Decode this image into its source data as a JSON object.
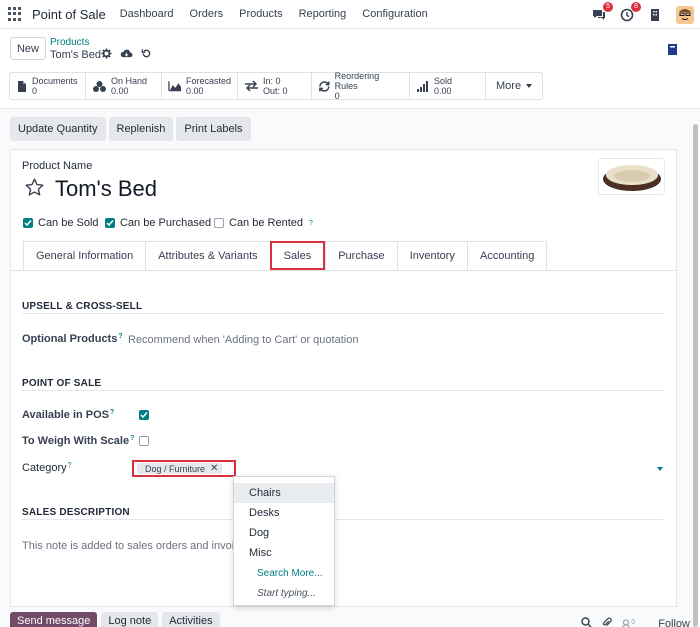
{
  "navbar": {
    "app_name": "Point of Sale",
    "menu": [
      "Dashboard",
      "Orders",
      "Products",
      "Reporting",
      "Configuration"
    ],
    "messages_count": "5",
    "activities_count": "8"
  },
  "control_panel": {
    "new_label": "New",
    "breadcrumb_parent": "Products",
    "breadcrumb_current": "Tom's Bed"
  },
  "smart_buttons": [
    {
      "label": "Documents",
      "value": "0",
      "icon": "document-icon"
    },
    {
      "label": "On Hand",
      "value": "0.00",
      "icon": "boxes-icon"
    },
    {
      "label": "Forecasted",
      "value": "0.00",
      "icon": "area-chart-icon"
    },
    {
      "label": "In: 0",
      "value": "Out: 0",
      "icon": "exchange-icon"
    },
    {
      "label": "Reordering Rules",
      "value": "0",
      "icon": "refresh-icon"
    },
    {
      "label": "Sold",
      "value": "0.00",
      "icon": "signal-icon"
    }
  ],
  "more_label": "More",
  "actions": [
    "Update Quantity",
    "Replenish",
    "Print Labels"
  ],
  "form": {
    "name_label": "Product Name",
    "product_name": "Tom's Bed",
    "can_be_sold": "Can be Sold",
    "can_be_purchased": "Can be Purchased",
    "can_be_rented": "Can be Rented",
    "tabs": [
      "General Information",
      "Attributes & Variants",
      "Sales",
      "Purchase",
      "Inventory",
      "Accounting"
    ],
    "upsell_title": "UPSELL & CROSS-SELL",
    "optional_products_label": "Optional Products",
    "optional_products_placeholder": "Recommend when 'Adding to Cart' or quotation",
    "pos_title": "POINT OF SALE",
    "available_pos_label": "Available in POS",
    "weigh_label": "To Weigh With Scale",
    "category_label": "Category",
    "category_value": "Dog / Furniture",
    "sales_desc_title": "SALES DESCRIPTION",
    "sales_desc_placeholder": "This note is added to sales orders and invoices."
  },
  "dropdown": {
    "items": [
      "Chairs",
      "Desks",
      "Dog",
      "Misc"
    ],
    "search_more": "Search More...",
    "start_typing": "Start typing..."
  },
  "chatter": {
    "send_message": "Send message",
    "log_note": "Log note",
    "activities": "Activities",
    "followers_count": "0",
    "follow": "Follow"
  },
  "colors": {
    "primary": "#714b67",
    "accent": "#017e84",
    "highlight": "#d9303e"
  }
}
